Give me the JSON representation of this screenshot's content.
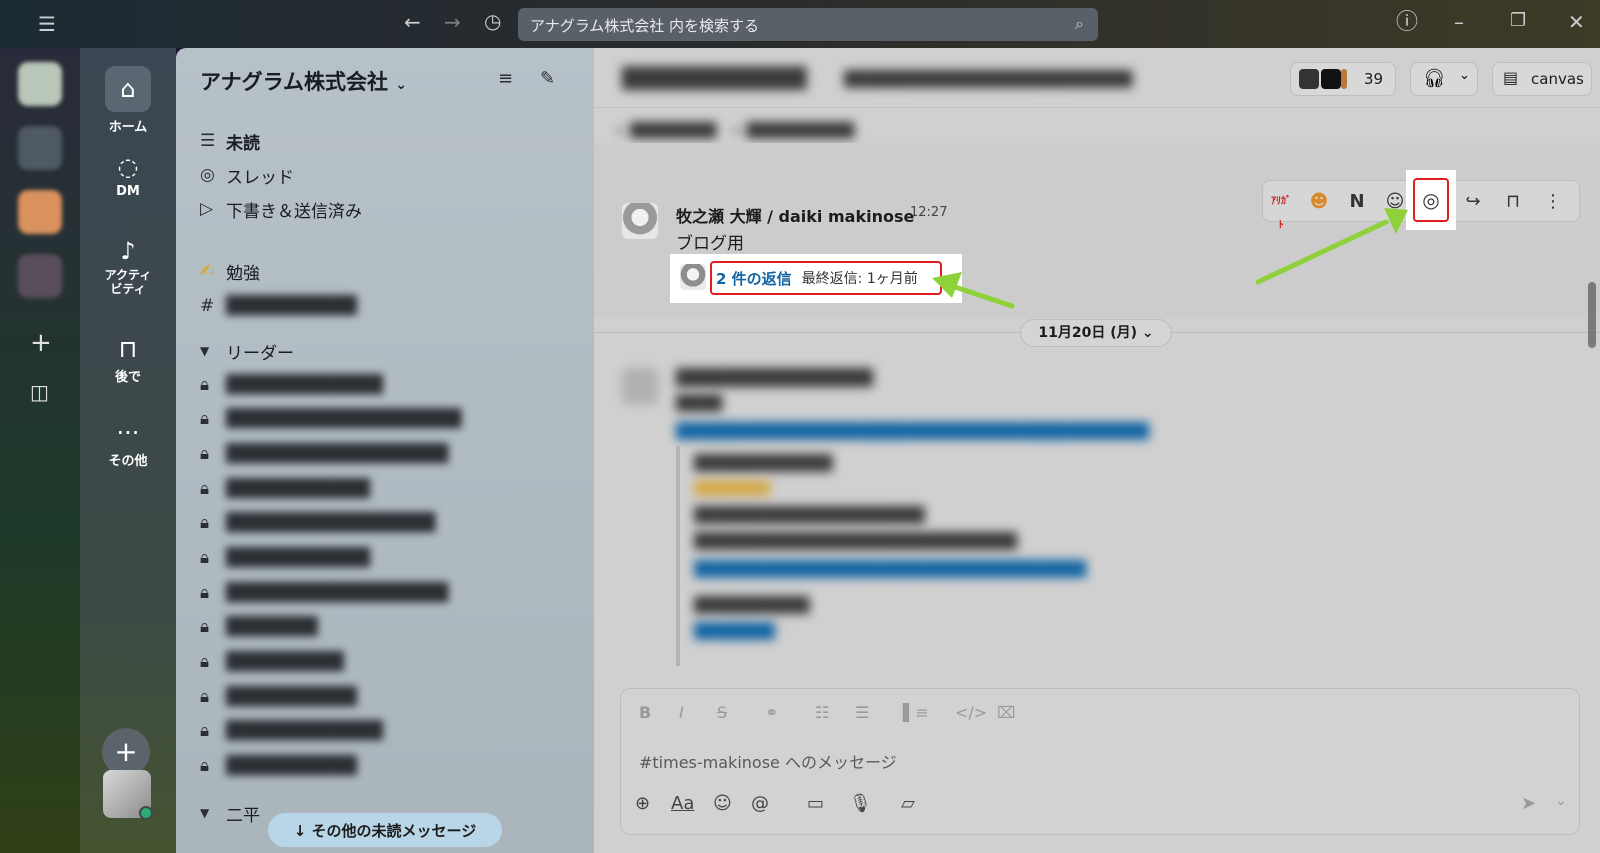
{
  "search": {
    "placeholder": "アナグラム株式会社 内を検索する"
  },
  "nav": {
    "home": "ホーム",
    "dm": "DM",
    "activity": "アクティビティ",
    "later": "後で",
    "more": "その他"
  },
  "sidebar": {
    "workspace": "アナグラム株式会社",
    "unread": "未読",
    "threads": "スレッド",
    "drafts": "下書き＆送信済み",
    "study": "勉強",
    "section_leader": "リーダー",
    "section_other": "二平",
    "more_unread": "↓ その他の未読メッセージ"
  },
  "header": {
    "member_count": "39",
    "canvas": "canvas"
  },
  "message": {
    "author": "牧之瀬 大輝 / daiki makinose",
    "time": "12:27",
    "text": "ブログ用"
  },
  "thread": {
    "reply_count": "2 件の返信",
    "last_reply": "最終返信: 1ヶ月前"
  },
  "date_divider": "11月20日 (月) ⌄",
  "composer": {
    "placeholder": "#times-makinose へのメッセージ"
  },
  "colors": {
    "highlight_border": "#e01e1e",
    "arrow": "#8fd13a",
    "link": "#1264a3"
  }
}
